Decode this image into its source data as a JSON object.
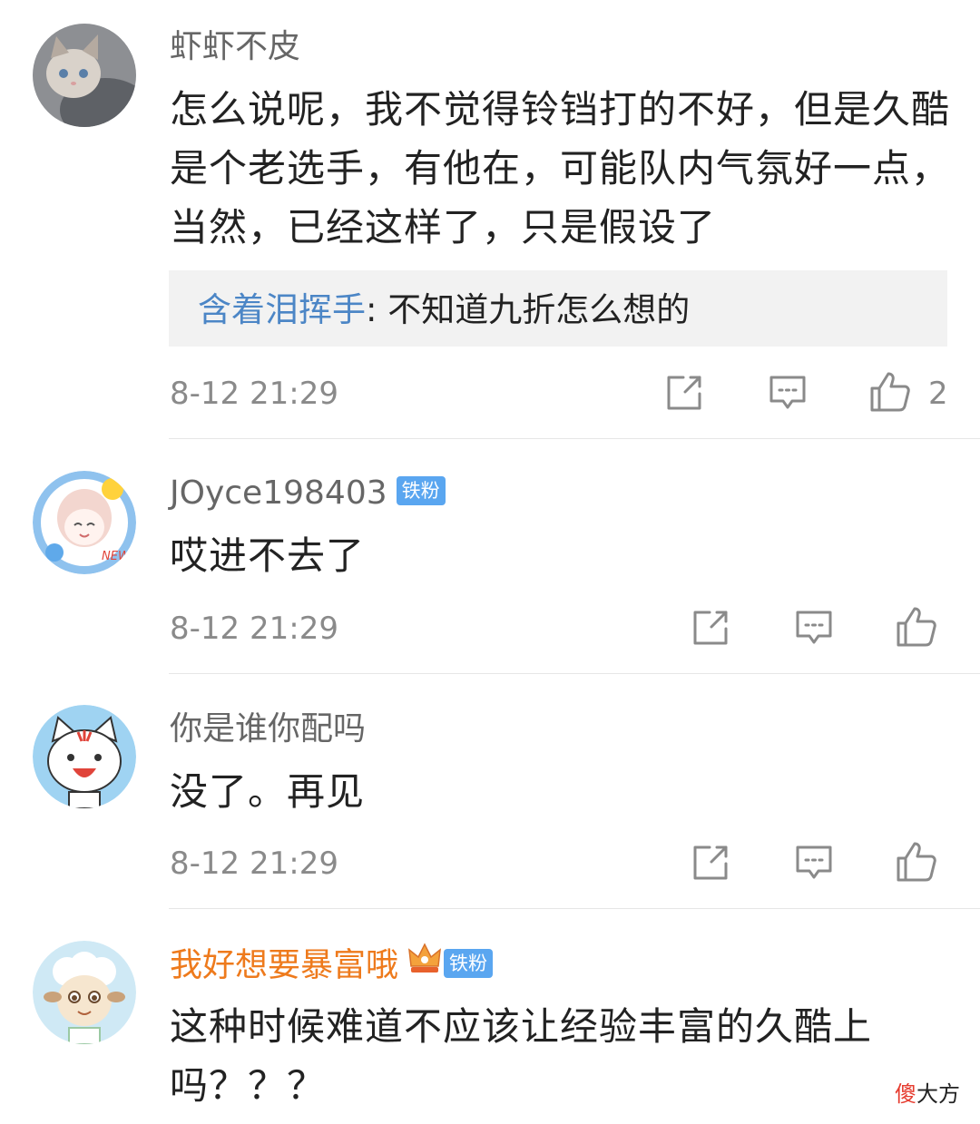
{
  "comments": [
    {
      "username": "虾虾不皮",
      "text": "怎么说呢，我不觉得铃铛打的不好，但是久酷是个老选手，有他在，可能队内气氛好一点，当然，已经这样了，只是假设了",
      "reply": {
        "user": "含着泪挥手",
        "separator": ": ",
        "text": "不知道九折怎么想的"
      },
      "time": "8-12 21:29",
      "likes": "2"
    },
    {
      "username": "JOyce198403",
      "badge": "铁粉",
      "text": "哎进不去了",
      "time": "8-12 21:29"
    },
    {
      "username": "你是谁你配吗",
      "text": "没了。再见",
      "time": "8-12 21:29"
    },
    {
      "username": "我好想要暴富哦",
      "badge": "铁粉",
      "text": "这种时候难道不应该让经验丰富的久酷上吗？？？"
    }
  ],
  "watermark": {
    "part1": "傻",
    "part2": "大方"
  },
  "colors": {
    "username": "#666666",
    "vip_username": "#ee7a1c",
    "reply_user": "#4c86c6",
    "badge": "#5aa6f0",
    "quote_bg": "#f2f2f2"
  },
  "icons": [
    "repost-icon",
    "comment-icon",
    "thumbs-up-icon",
    "crown-icon"
  ]
}
